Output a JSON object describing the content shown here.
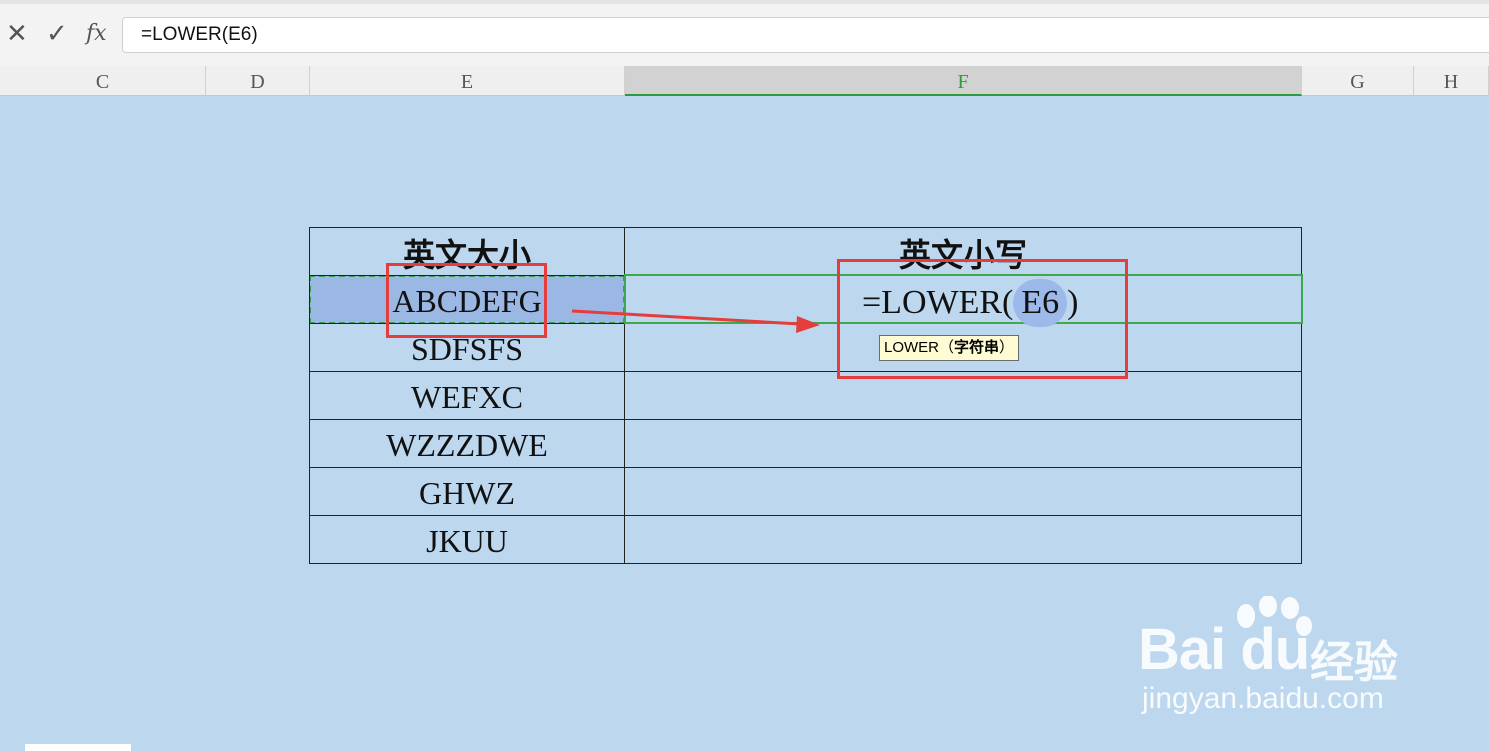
{
  "formula_bar": {
    "cancel_icon": "close-icon",
    "confirm_icon": "check-icon",
    "fx_label": "fx",
    "formula": "=LOWER(E6)"
  },
  "columns": [
    {
      "label": "C"
    },
    {
      "label": "D"
    },
    {
      "label": "E"
    },
    {
      "label": "F",
      "active": true
    },
    {
      "label": "G"
    },
    {
      "label": "H"
    }
  ],
  "table": {
    "header": {
      "e": "英文大小",
      "f": "英文小写"
    },
    "rows": [
      {
        "e": "ABCDEFG",
        "f": ""
      },
      {
        "e": "SDFSFS",
        "f": ""
      },
      {
        "e": "WEFXC",
        "f": ""
      },
      {
        "e": "WZZZDWE",
        "f": ""
      },
      {
        "e": "GHWZ",
        "f": ""
      },
      {
        "e": "JKUU",
        "f": ""
      }
    ]
  },
  "editing": {
    "prefix": "=LOWER(",
    "ref": "E6",
    "suffix": ")",
    "tooltip_func": "LOWER（",
    "tooltip_arg": "字符串",
    "tooltip_close": "）"
  },
  "watermark": {
    "logo": "Bai du",
    "cn": "经验",
    "url": "jingyan.baidu.com"
  },
  "colors": {
    "sheet_bg": "#bdd7ee",
    "selection_fill": "#9bb7e3",
    "active_green": "#2e9b3e",
    "annotation_red": "#e53d3d"
  }
}
